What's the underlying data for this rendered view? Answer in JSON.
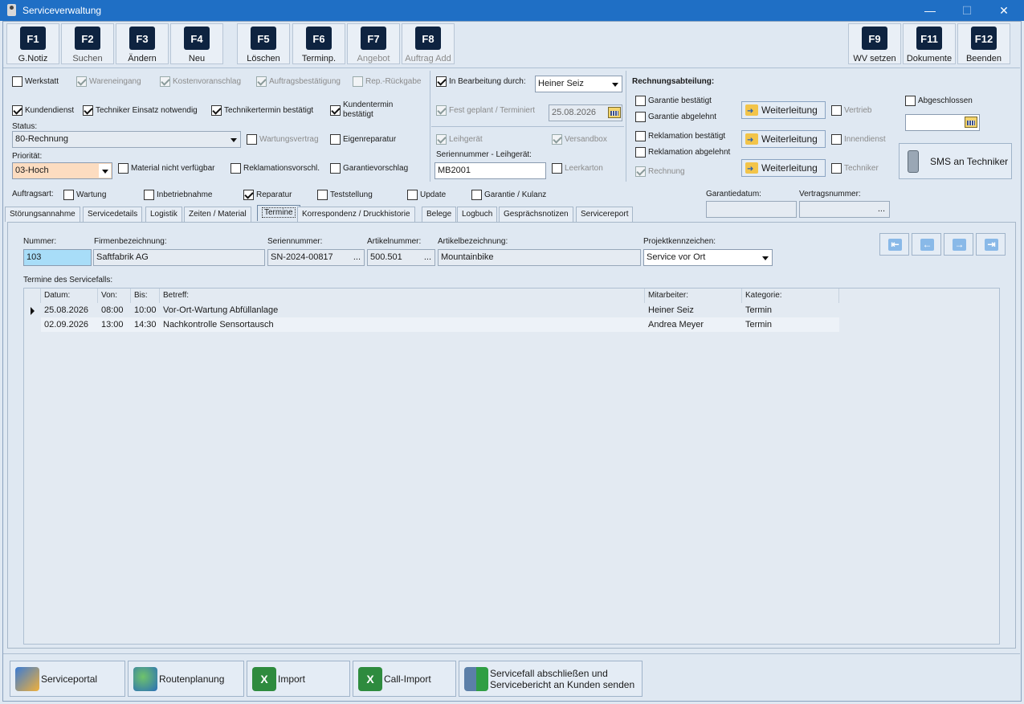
{
  "window": {
    "title": "Serviceverwaltung",
    "minimize": "—",
    "maximize": "☐",
    "close": "✕"
  },
  "fkeys": [
    {
      "key": "F1",
      "label": "G.Notiz",
      "enabled": true
    },
    {
      "key": "F2",
      "label": "Suchen",
      "enabled": true
    },
    {
      "key": "F3",
      "label": "Ändern",
      "enabled": true
    },
    {
      "key": "F4",
      "label": "Neu",
      "enabled": true
    },
    {
      "key": "F5",
      "label": "Löschen",
      "enabled": true
    },
    {
      "key": "F6",
      "label": "Terminp.",
      "enabled": true
    },
    {
      "key": "F7",
      "label": "Angebot",
      "enabled": false
    },
    {
      "key": "F8",
      "label": "Auftrag Add",
      "enabled": false
    },
    {
      "key": "F9",
      "label": "WV setzen",
      "enabled": true
    },
    {
      "key": "F11",
      "label": "Dokumente",
      "enabled": true
    },
    {
      "key": "F12",
      "label": "Beenden",
      "enabled": true
    }
  ],
  "checks": {
    "werkstatt": {
      "label": "Werkstatt",
      "checked": false
    },
    "wareneingang": {
      "label": "Wareneingang",
      "checked": true
    },
    "kostenvoranschlag": {
      "label": "Kostenvoranschlag",
      "checked": true
    },
    "auftragsbestaetigung": {
      "label": "Auftragsbestätigung",
      "checked": true
    },
    "rep_rueckgabe": {
      "label": "Rep.-Rückgabe",
      "checked": false
    },
    "kundendienst": {
      "label": "Kundendienst",
      "checked": true
    },
    "techniker_einsatz": {
      "label": "Techniker Einsatz notwendig",
      "checked": true
    },
    "technikertermin": {
      "label": "Technikertermin bestätigt",
      "checked": true
    },
    "kundentermin": {
      "label": "Kundentermin bestätigt",
      "checked": true
    },
    "wartungsvertrag": {
      "label": "Wartungsvertrag",
      "checked": false
    },
    "eigenreparatur": {
      "label": "Eigenreparatur",
      "checked": false
    },
    "material": {
      "label": "Material nicht verfügbar",
      "checked": false
    },
    "reklamationsvorschl": {
      "label": "Reklamationsvorschl.",
      "checked": false
    },
    "garantievorschlag": {
      "label": "Garantievorschlag",
      "checked": false
    },
    "in_bearbeitung": {
      "label": "In Bearbeitung durch:",
      "checked": true
    },
    "fest_geplant": {
      "label": "Fest geplant / Terminiert",
      "checked": true
    },
    "leihgeraet": {
      "label": "Leihgerät",
      "checked": true
    },
    "versandbox": {
      "label": "Versandbox",
      "checked": true
    },
    "leerkarton": {
      "label": "Leerkarton",
      "checked": false
    },
    "garantie_bestaetigt": {
      "label": "Garantie bestätigt",
      "checked": false
    },
    "garantie_abgelehnt": {
      "label": "Garantie abgelehnt",
      "checked": false
    },
    "reklamation_bestaetigt": {
      "label": "Reklamation bestätigt",
      "checked": false
    },
    "reklamation_abgelehnt": {
      "label": "Reklamation abgelehnt",
      "checked": false
    },
    "rechnung": {
      "label": "Rechnung",
      "checked": true
    },
    "vertrieb": {
      "label": "Vertrieb",
      "checked": false
    },
    "innendienst": {
      "label": "Innendienst",
      "checked": false
    },
    "techniker": {
      "label": "Techniker",
      "checked": false
    },
    "abgeschlossen": {
      "label": "Abgeschlossen",
      "checked": false
    }
  },
  "status": {
    "label": "Status:",
    "value": "80-Rechnung"
  },
  "prioritaet": {
    "label": "Priorität:",
    "value": "03-Hoch"
  },
  "bearbeiter": {
    "value": "Heiner Seiz"
  },
  "termin_datum": "25.08.2026",
  "seriennummer_leihgeraet": {
    "label": "Seriennummer - Leihgerät:",
    "value": "MB2001"
  },
  "rechnungsabteilung": {
    "title": "Rechnungsabteilung:",
    "weiterleitung": "Weiterleitung",
    "sms": "SMS an Techniker"
  },
  "auftragsart": {
    "label": "Auftragsart:",
    "items": [
      {
        "label": "Wartung",
        "checked": false
      },
      {
        "label": "Inbetriebnahme",
        "checked": false
      },
      {
        "label": "Reparatur",
        "checked": true
      },
      {
        "label": "Teststellung",
        "checked": false
      },
      {
        "label": "Update",
        "checked": false
      },
      {
        "label": "Garantie / Kulanz",
        "checked": false
      }
    ]
  },
  "garantiedatum": {
    "label": "Garantiedatum:",
    "value": ""
  },
  "vertragsnummer": {
    "label": "Vertragsnummer:",
    "value": "",
    "ellipsis": "..."
  },
  "tabs": [
    "Störungsannahme",
    "Servicedetails",
    "Logistik",
    "Zeiten / Material",
    "Termine",
    "Korrespondenz / Druckhistorie",
    "Belege",
    "Logbuch",
    "Gesprächsnotizen",
    "Servicereport"
  ],
  "active_tab": "Termine",
  "fields": {
    "nummer": {
      "label": "Nummer:",
      "value": "103"
    },
    "firma": {
      "label": "Firmenbezeichnung:",
      "value": "Saftfabrik AG"
    },
    "seriennummer": {
      "label": "Seriennummer:",
      "value": "SN-2024-00817"
    },
    "artikelnummer": {
      "label": "Artikelnummer:",
      "value": "500.501"
    },
    "artikelbezeichnung": {
      "label": "Artikelbezeichnung:",
      "value": "Mountainbike"
    },
    "projekt": {
      "label": "Projektkennzeichen:",
      "value": "Service vor Ort"
    },
    "ellipsis": "..."
  },
  "nav": [
    "⇤",
    "←",
    "→",
    "⇥"
  ],
  "termine": {
    "title": "Termine des Servicefalls:",
    "columns": [
      "Datum:",
      "Von:",
      "Bis:",
      "Betreff:",
      "Mitarbeiter:",
      "Kategorie:"
    ],
    "rows": [
      {
        "datum": "25.08.2026",
        "von": "08:00",
        "bis": "10:00",
        "betreff": "Vor-Ort-Wartung Abfüllanlage",
        "mitarbeiter": "Heiner Seiz",
        "kategorie": "Termin",
        "current": true
      },
      {
        "datum": "02.09.2026",
        "von": "13:00",
        "bis": "14:30",
        "betreff": "Nachkontrolle Sensortausch",
        "mitarbeiter": "Andrea Meyer",
        "kategorie": "Termin",
        "current": false
      }
    ]
  },
  "bottom": {
    "serviceportal": "Serviceportal",
    "routenplanung": "Routenplanung",
    "import": "Import",
    "callimport": "Call-Import",
    "abschliessen_1": "Servicefall abschließen und",
    "abschliessen_2": "Servicebericht an Kunden senden"
  }
}
